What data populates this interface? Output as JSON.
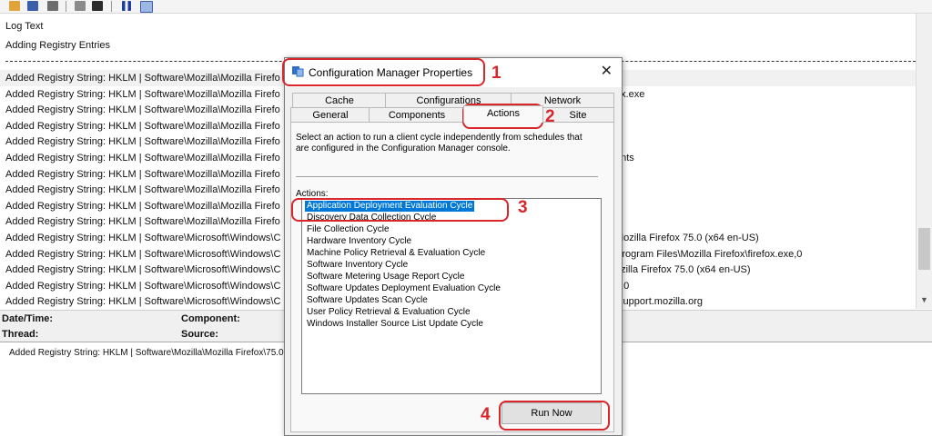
{
  "log": {
    "column_header": "Log Text",
    "first_line": "Adding Registry Entries",
    "rows": [
      {
        "text": "Added Registry String: HKLM | Software\\Mozilla\\Mozilla Firefo",
        "right": ""
      },
      {
        "text": "Added Registry String: HKLM | Software\\Mozilla\\Mozilla Firefo",
        "right": "ox.exe"
      },
      {
        "text": "Added Registry String: HKLM | Software\\Mozilla\\Mozilla Firefo",
        "right": ""
      },
      {
        "text": "Added Registry String: HKLM | Software\\Mozilla\\Mozilla Firefo",
        "right": ""
      },
      {
        "text": "Added Registry String: HKLM | Software\\Mozilla\\Mozilla Firefo",
        "right": ""
      },
      {
        "text": "Added Registry String: HKLM | Software\\Mozilla\\Mozilla Firefo",
        "right": "ents"
      },
      {
        "text": "Added Registry String: HKLM | Software\\Mozilla\\Mozilla Firefo",
        "right": ""
      },
      {
        "text": "Added Registry String: HKLM | Software\\Mozilla\\Mozilla Firefo",
        "right": ""
      },
      {
        "text": "Added Registry String: HKLM | Software\\Mozilla\\Mozilla Firefo",
        "right": ""
      },
      {
        "text": "Added Registry String: HKLM | Software\\Mozilla\\Mozilla Firefo",
        "right": ""
      },
      {
        "text": "Added Registry String: HKLM | Software\\Microsoft\\Windows\\C",
        "right": "Mozilla Firefox 75.0 (x64 en-US)"
      },
      {
        "text": "Added Registry String: HKLM | Software\\Microsoft\\Windows\\C",
        "right": "Program Files\\Mozilla Firefox\\firefox.exe,0"
      },
      {
        "text": "Added Registry String: HKLM | Software\\Microsoft\\Windows\\C",
        "right": "ozilla Firefox 75.0 (x64 en-US)"
      },
      {
        "text": "Added Registry String: HKLM | Software\\Microsoft\\Windows\\C",
        "right": "5.0"
      },
      {
        "text": "Added Registry String: HKLM | Software\\Microsoft\\Windows\\C",
        "right": "/support.mozilla.org"
      }
    ]
  },
  "details": {
    "datetime_label": "Date/Time:",
    "component_label": "Component:",
    "thread_label": "Thread:",
    "source_label": "Source:"
  },
  "message": {
    "text": "Added Registry String: HKLM | Software\\Mozilla\\Mozilla Firefox\\75.0"
  },
  "toolbar": {
    "icons": [
      "open-folder-icon",
      "save-icon",
      "print-icon",
      "copy-icon",
      "find-icon",
      "pause-icon",
      "highlight-icon"
    ]
  },
  "dialog": {
    "title": "Configuration Manager Properties",
    "close_glyph": "✕",
    "tabs_top": [
      "Cache",
      "Configurations",
      "Network"
    ],
    "tabs_bottom": [
      "General",
      "Components",
      "Actions",
      "Site"
    ],
    "active_tab": "Actions",
    "description": "Select an action to run a client cycle independently from schedules that are configured in the Configuration Manager console.",
    "actions_label": "Actions:",
    "actions": [
      "Application Deployment Evaluation Cycle",
      "Discovery Data Collection Cycle",
      "File Collection Cycle",
      "Hardware Inventory Cycle",
      "Machine Policy Retrieval & Evaluation Cycle",
      "Software Inventory Cycle",
      "Software Metering Usage Report Cycle",
      "Software Updates Deployment Evaluation Cycle",
      "Software Updates Scan Cycle",
      "User Policy Retrieval & Evaluation Cycle",
      "Windows Installer Source List Update Cycle"
    ],
    "selected_action": "Application Deployment Evaluation Cycle",
    "run_button": "Run Now"
  },
  "annotations": [
    "1",
    "2",
    "3",
    "4"
  ],
  "colors": {
    "annotation_red": "#d9262a",
    "selection_blue": "#0078d7"
  }
}
